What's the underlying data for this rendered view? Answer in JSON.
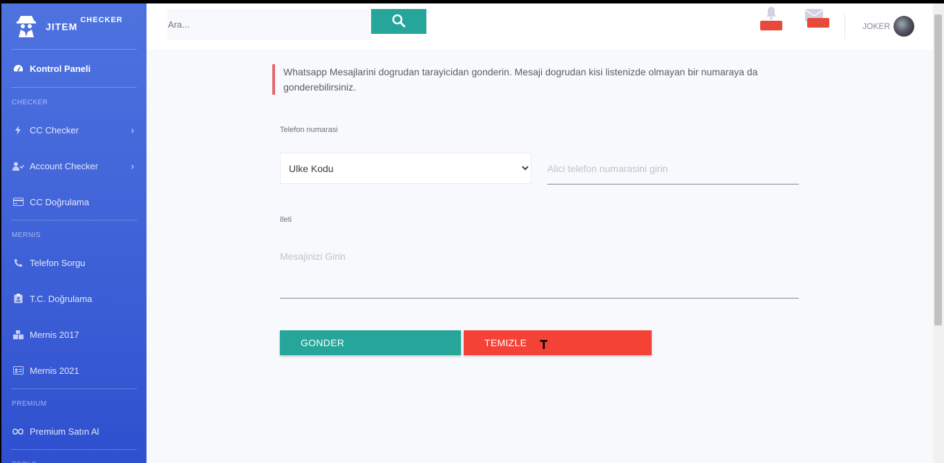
{
  "brand": {
    "name": "JITEM",
    "suffix": "CHECKER"
  },
  "sidebar": {
    "dashboard": {
      "label": "Kontrol Paneli",
      "icon": "tachometer-icon"
    },
    "sections": [
      {
        "title": "CHECKER",
        "items": [
          {
            "label": "CC Checker",
            "icon": "bolt-icon",
            "has_arrow": true
          },
          {
            "label": "Account Checker",
            "icon": "user-check-icon",
            "has_arrow": true
          },
          {
            "label": "CC Doğrulama",
            "icon": "credit-card-icon",
            "has_arrow": false
          }
        ]
      },
      {
        "title": "MERNIS",
        "items": [
          {
            "label": "Telefon Sorgu",
            "icon": "phone-icon"
          },
          {
            "label": "T.C. Doğrulama",
            "icon": "id-badge-icon"
          },
          {
            "label": "Mernis 2017",
            "icon": "boxes-icon"
          },
          {
            "label": "Mernis 2021",
            "icon": "id-card-icon"
          }
        ]
      },
      {
        "title": "PREMIUM",
        "items": [
          {
            "label": "Premium Satın Al",
            "icon": "infinity-icon"
          }
        ]
      },
      {
        "title": "TOOLS",
        "items": []
      }
    ],
    "chevron": "›"
  },
  "topbar": {
    "search": {
      "placeholder": "Ara..."
    },
    "user": {
      "name": "JOKER"
    }
  },
  "main": {
    "info_text": "Whatsapp Mesajlarini dogrudan tarayicidan gonderin. Mesaji dogrudan kisi listenizde olmayan bir numaraya da gonderebilirsiniz.",
    "phone_label": "Telefon numarasi",
    "country_select": {
      "selected": "Ulke Kodu"
    },
    "phone_input": {
      "placeholder": "Alici telefon numarasini girin"
    },
    "message_label": "Ileti",
    "message_input": {
      "placeholder": "Mesajinizi Girin"
    },
    "send_button": "GONDER",
    "clear_button": "TEMIZLE"
  },
  "colors": {
    "sidebar": "#4e73df",
    "teal": "#26a69a",
    "red": "#f44336",
    "note_border": "#e9636b"
  }
}
